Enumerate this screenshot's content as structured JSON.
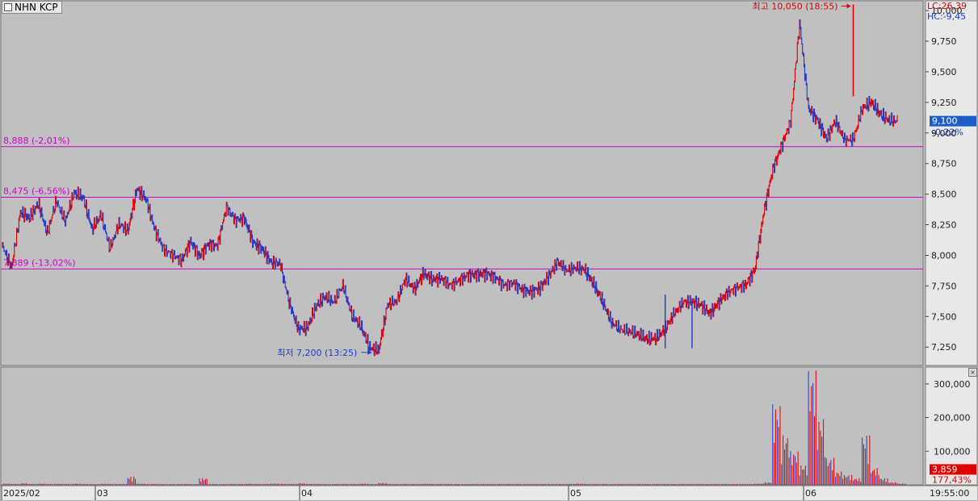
{
  "window": {
    "title": "NHN KCP",
    "corner_button": "×"
  },
  "indicators": {
    "lc": "LC:26,39",
    "hc": "HC:-9,45"
  },
  "price_panel": {
    "current_price_label": "9,100",
    "current_change_label": "-0,22%",
    "high_annotation": "최고 10,050 (18:55)",
    "low_annotation": "최저 7,200 (13:25)",
    "y_ticks": [
      "10,000",
      "9,750",
      "9,500",
      "9,250",
      "9,000",
      "8,750",
      "8,500",
      "8,250",
      "8,000",
      "7,750",
      "7,500",
      "7,250"
    ],
    "y_range": [
      7100,
      10080
    ],
    "levels": [
      {
        "label": "8,888 (-2,01%)",
        "value": 8888,
        "color": "#d000d0"
      },
      {
        "label": "8,475 (-6,56%)",
        "value": 8475,
        "color": "#d000d0"
      },
      {
        "label": "7,889 (-13,02%)",
        "value": 7889,
        "color": "#d000d0"
      }
    ]
  },
  "volume_panel": {
    "current_volume_label": "3,859",
    "current_ratio_label": "177,43%",
    "y_ticks": [
      "300,000",
      "200,000",
      "100,000"
    ],
    "y_range": [
      0,
      350000
    ]
  },
  "x_axis": {
    "ticks": [
      "2025/02",
      "03",
      "04",
      "05",
      "06"
    ],
    "time_label": "19:55:00"
  },
  "colors": {
    "up": "#e00000",
    "down": "#1a3cd0",
    "level_line": "#d000d0",
    "price_box": "#1e5cc8",
    "volume_box": "#e00000"
  },
  "chart_data": {
    "type": "line",
    "title": "NHN KCP",
    "x_range": [
      "2025/02",
      "06"
    ],
    "ylim": [
      7100,
      10080
    ],
    "series": [
      {
        "x": [
          0,
          2,
          4,
          6,
          8,
          10,
          12,
          14,
          16,
          18,
          20,
          22,
          24,
          26,
          28,
          30,
          32,
          34,
          36,
          38,
          40,
          42,
          44,
          46,
          48,
          50,
          52,
          54,
          56,
          58,
          60,
          62,
          64,
          66,
          68,
          70,
          72,
          74,
          76,
          78,
          80,
          82,
          84,
          86,
          88,
          90,
          92,
          94,
          96,
          98,
          100,
          102,
          104,
          106,
          108,
          110,
          112,
          114,
          116,
          118,
          120,
          122,
          124,
          126,
          128,
          130,
          132,
          134,
          136,
          138,
          140,
          142,
          144,
          146,
          148,
          150,
          152,
          154,
          156,
          158,
          160,
          162,
          164,
          166,
          168,
          170,
          172,
          174,
          176,
          178,
          180,
          182,
          184,
          186,
          188,
          190,
          192,
          194,
          196,
          198,
          200
        ],
        "values": [
          8080,
          7900,
          8350,
          8300,
          8420,
          8180,
          8450,
          8280,
          8510,
          8470,
          8210,
          8330,
          8060,
          8260,
          8200,
          8540,
          8460,
          8210,
          8050,
          8010,
          7960,
          8110,
          7990,
          8090,
          8080,
          8400,
          8290,
          8300,
          8100,
          8050,
          7940,
          7940,
          7620,
          7400,
          7400,
          7580,
          7660,
          7620,
          7760,
          7510,
          7420,
          7240,
          7220,
          7600,
          7630,
          7810,
          7720,
          7850,
          7800,
          7810,
          7760,
          7800,
          7840,
          7840,
          7850,
          7820,
          7760,
          7780,
          7720,
          7700,
          7730,
          7830,
          7950,
          7880,
          7900,
          7880,
          7760,
          7620,
          7450,
          7400,
          7380,
          7350,
          7310,
          7320,
          7400,
          7530,
          7620,
          7620,
          7590,
          7520,
          7620,
          7700,
          7740,
          7760,
          7880,
          8350,
          8700,
          8900,
          9100,
          9900,
          9200,
          9100,
          8950,
          9100,
          8950,
          8950,
          9200,
          9250,
          9150,
          9100,
          9100
        ]
      }
    ],
    "volume": {
      "ylim": [
        0,
        350000
      ],
      "values": [
        4000,
        3000,
        5000,
        3000,
        4000,
        3000,
        3500,
        3000,
        4000,
        3000,
        2500,
        3500,
        3000,
        3000,
        25000,
        4000,
        3000,
        3000,
        2500,
        3000,
        3000,
        2500,
        20000,
        3000,
        2500,
        3000,
        3000,
        3500,
        3000,
        3000,
        4000,
        3500,
        3000,
        5000,
        3000,
        3000,
        2500,
        3000,
        3000,
        3000,
        4000,
        2500,
        6000,
        3000,
        3000,
        3000,
        3000,
        3500,
        3000,
        3000,
        3000,
        2500,
        3000,
        3000,
        3000,
        3000,
        3000,
        3000,
        3000,
        3000,
        3000,
        3000,
        3000,
        3000,
        4000,
        3000,
        3000,
        3000,
        3000,
        3000,
        3000,
        3000,
        3000,
        3000,
        3000,
        3000,
        3000,
        3000,
        3000,
        3000,
        3000,
        3000,
        3000,
        3000,
        4000,
        8000,
        240000,
        150000,
        100000,
        60000,
        340000,
        200000,
        80000,
        40000,
        30000,
        20000,
        150000,
        50000,
        20000,
        8000,
        3859
      ]
    }
  }
}
